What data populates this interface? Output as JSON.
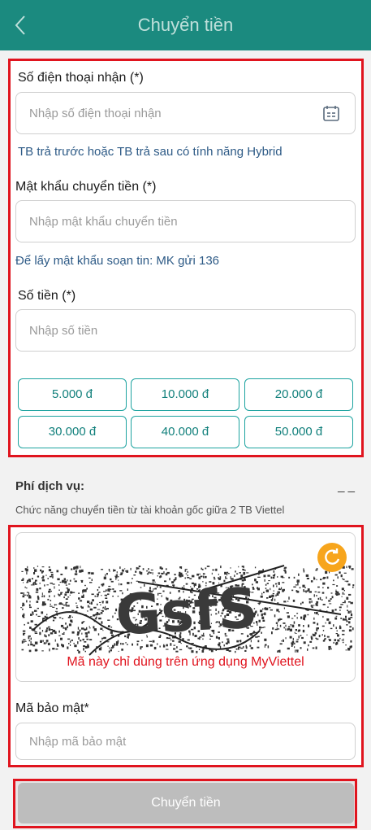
{
  "header": {
    "title": "Chuyển tiền",
    "back_icon": "chevron-left-icon"
  },
  "recipient": {
    "label": "Số điện thoại nhận (*)",
    "placeholder": "Nhập số điện thoại nhận",
    "contact_icon": "contact-book-icon",
    "hint": "TB trả trước hoặc TB trả sau có tính năng Hybrid"
  },
  "password": {
    "label": "Mật khẩu chuyển tiền (*)",
    "placeholder": "Nhập mật khẩu chuyển tiền",
    "hint": "Để lấy mật khẩu soạn tin: MK gửi 136"
  },
  "amount": {
    "label": "Số tiền (*)",
    "placeholder": "Nhập số tiền",
    "options": [
      "5.000 đ",
      "10.000 đ",
      "20.000 đ",
      "30.000 đ",
      "40.000 đ",
      "50.000 đ"
    ]
  },
  "fee": {
    "label": "Phí dịch vụ:",
    "value": "_ _",
    "note": "Chức năng chuyển tiền từ tài khoản gốc giữa 2 TB Viettel"
  },
  "captcha": {
    "image_text": "GsfS",
    "note": "Mã này chỉ dùng trên ứng dụng MyViettel",
    "refresh_icon": "refresh-icon"
  },
  "security_code": {
    "label": "Mã bảo mật*",
    "placeholder": "Nhập mã bảo mật"
  },
  "submit_label": "Chuyển tiền",
  "colors": {
    "header": "#1b8a7f",
    "highlight": "#e0141e",
    "accent": "#1da3a0",
    "refresh": "#f7a51c"
  }
}
